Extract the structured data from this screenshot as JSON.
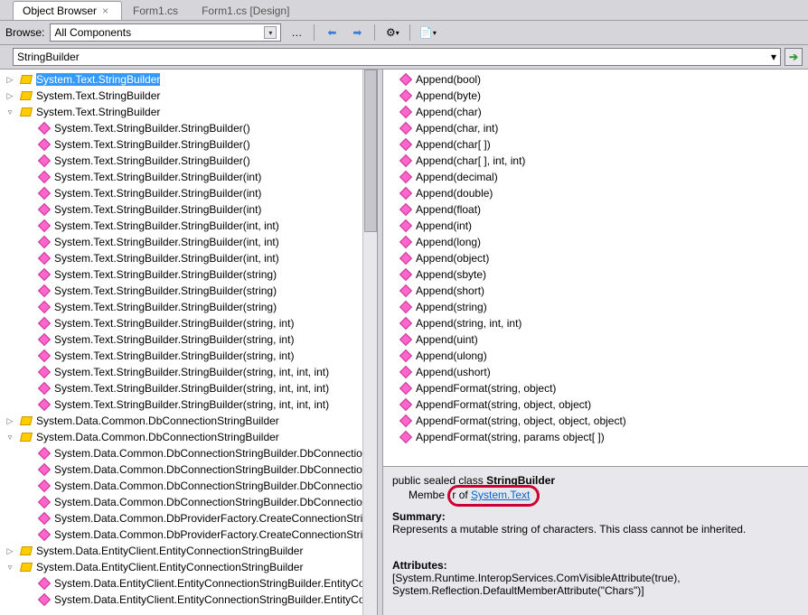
{
  "tabs": [
    {
      "label": "Object Browser",
      "active": true,
      "closable": true
    },
    {
      "label": "Form1.cs",
      "active": false,
      "closable": false
    },
    {
      "label": "Form1.cs [Design]",
      "active": false,
      "closable": false
    }
  ],
  "toolbar": {
    "browse_label": "Browse:",
    "scope": "All Components"
  },
  "search": {
    "value": "StringBuilder"
  },
  "tree": [
    {
      "d": 0,
      "exp": "▷",
      "icon": "class",
      "label": "System.Text.StringBuilder",
      "sel": true
    },
    {
      "d": 0,
      "exp": "▷",
      "icon": "class",
      "label": "System.Text.StringBuilder"
    },
    {
      "d": 0,
      "exp": "▿",
      "icon": "class",
      "label": "System.Text.StringBuilder"
    },
    {
      "d": 1,
      "exp": "",
      "icon": "method",
      "label": "System.Text.StringBuilder.StringBuilder()"
    },
    {
      "d": 1,
      "exp": "",
      "icon": "method",
      "label": "System.Text.StringBuilder.StringBuilder()"
    },
    {
      "d": 1,
      "exp": "",
      "icon": "method",
      "label": "System.Text.StringBuilder.StringBuilder()"
    },
    {
      "d": 1,
      "exp": "",
      "icon": "method",
      "label": "System.Text.StringBuilder.StringBuilder(int)"
    },
    {
      "d": 1,
      "exp": "",
      "icon": "method",
      "label": "System.Text.StringBuilder.StringBuilder(int)"
    },
    {
      "d": 1,
      "exp": "",
      "icon": "method",
      "label": "System.Text.StringBuilder.StringBuilder(int)"
    },
    {
      "d": 1,
      "exp": "",
      "icon": "method",
      "label": "System.Text.StringBuilder.StringBuilder(int, int)"
    },
    {
      "d": 1,
      "exp": "",
      "icon": "method",
      "label": "System.Text.StringBuilder.StringBuilder(int, int)"
    },
    {
      "d": 1,
      "exp": "",
      "icon": "method",
      "label": "System.Text.StringBuilder.StringBuilder(int, int)"
    },
    {
      "d": 1,
      "exp": "",
      "icon": "method",
      "label": "System.Text.StringBuilder.StringBuilder(string)"
    },
    {
      "d": 1,
      "exp": "",
      "icon": "method",
      "label": "System.Text.StringBuilder.StringBuilder(string)"
    },
    {
      "d": 1,
      "exp": "",
      "icon": "method",
      "label": "System.Text.StringBuilder.StringBuilder(string)"
    },
    {
      "d": 1,
      "exp": "",
      "icon": "method",
      "label": "System.Text.StringBuilder.StringBuilder(string, int)"
    },
    {
      "d": 1,
      "exp": "",
      "icon": "method",
      "label": "System.Text.StringBuilder.StringBuilder(string, int)"
    },
    {
      "d": 1,
      "exp": "",
      "icon": "method",
      "label": "System.Text.StringBuilder.StringBuilder(string, int)"
    },
    {
      "d": 1,
      "exp": "",
      "icon": "method",
      "label": "System.Text.StringBuilder.StringBuilder(string, int, int, int)"
    },
    {
      "d": 1,
      "exp": "",
      "icon": "method",
      "label": "System.Text.StringBuilder.StringBuilder(string, int, int, int)"
    },
    {
      "d": 1,
      "exp": "",
      "icon": "method",
      "label": "System.Text.StringBuilder.StringBuilder(string, int, int, int)"
    },
    {
      "d": 0,
      "exp": "▷",
      "icon": "class",
      "label": "System.Data.Common.DbConnectionStringBuilder"
    },
    {
      "d": 0,
      "exp": "▿",
      "icon": "class",
      "label": "System.Data.Common.DbConnectionStringBuilder"
    },
    {
      "d": 1,
      "exp": "",
      "icon": "method",
      "label": "System.Data.Common.DbConnectionStringBuilder.DbConnectio"
    },
    {
      "d": 1,
      "exp": "",
      "icon": "method",
      "label": "System.Data.Common.DbConnectionStringBuilder.DbConnectio"
    },
    {
      "d": 1,
      "exp": "",
      "icon": "method",
      "label": "System.Data.Common.DbConnectionStringBuilder.DbConnectio"
    },
    {
      "d": 1,
      "exp": "",
      "icon": "method",
      "label": "System.Data.Common.DbConnectionStringBuilder.DbConnectio"
    },
    {
      "d": 1,
      "exp": "",
      "icon": "method",
      "label": "System.Data.Common.DbProviderFactory.CreateConnectionStrin"
    },
    {
      "d": 1,
      "exp": "",
      "icon": "method",
      "label": "System.Data.Common.DbProviderFactory.CreateConnectionStrin"
    },
    {
      "d": 0,
      "exp": "▷",
      "icon": "class",
      "label": "System.Data.EntityClient.EntityConnectionStringBuilder"
    },
    {
      "d": 0,
      "exp": "▿",
      "icon": "class",
      "label": "System.Data.EntityClient.EntityConnectionStringBuilder"
    },
    {
      "d": 1,
      "exp": "",
      "icon": "method",
      "label": "System.Data.EntityClient.EntityConnectionStringBuilder.EntityCo"
    },
    {
      "d": 1,
      "exp": "",
      "icon": "method",
      "label": "System.Data.EntityClient.EntityConnectionStringBuilder.EntityCo"
    }
  ],
  "members": [
    "Append(bool)",
    "Append(byte)",
    "Append(char)",
    "Append(char, int)",
    "Append(char[ ])",
    "Append(char[ ], int, int)",
    "Append(decimal)",
    "Append(double)",
    "Append(float)",
    "Append(int)",
    "Append(long)",
    "Append(object)",
    "Append(sbyte)",
    "Append(short)",
    "Append(string)",
    "Append(string, int, int)",
    "Append(uint)",
    "Append(ulong)",
    "Append(ushort)",
    "AppendFormat(string, object)",
    "AppendFormat(string, object, object)",
    "AppendFormat(string, object, object, object)",
    "AppendFormat(string, params object[ ])"
  ],
  "desc": {
    "sig_pre": "public sealed class ",
    "sig_name": "StringBuilder",
    "memberof_pre": "Member of ",
    "memberof_link": "System.Text",
    "summary_h": "Summary:",
    "summary_t": "Represents a mutable string of characters. This class cannot be inherited.",
    "attr_h": "Attributes:",
    "attr_t": "[System.Runtime.InteropServices.ComVisibleAttribute(true), System.Reflection.DefaultMemberAttribute(\"Chars\")]"
  }
}
